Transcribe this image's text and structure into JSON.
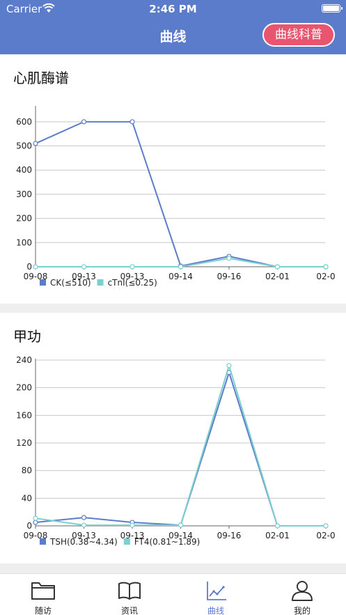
{
  "status": {
    "carrier": "Carrier",
    "time": "2:46 PM"
  },
  "header": {
    "title": "曲线",
    "science_button": "曲线科普"
  },
  "cards": [
    {
      "title": "心肌酶谱",
      "chart_data": {
        "type": "line",
        "categories": [
          "09-08",
          "09-13",
          "09-13",
          "09-14",
          "09-16",
          "02-01",
          "02-0"
        ],
        "ylim": [
          0,
          660
        ],
        "yticks": [
          0,
          100,
          200,
          300,
          400,
          500,
          600
        ],
        "series": [
          {
            "name": "CK(≤510)",
            "color": "#5b7ccb",
            "values": [
              510,
              600,
              600,
              3,
              43,
              0,
              0
            ]
          },
          {
            "name": "cTnI(≤0.25)",
            "color": "#7ccfcf",
            "values": [
              0,
              0,
              0,
              0,
              35,
              0,
              0
            ]
          }
        ]
      }
    },
    {
      "title": "甲功",
      "chart_data": {
        "type": "line",
        "categories": [
          "09-08",
          "09-13",
          "09-13",
          "09-14",
          "09-16",
          "02-01",
          "02-0"
        ],
        "ylim": [
          0,
          240
        ],
        "yticks": [
          0,
          40,
          80,
          120,
          160,
          200,
          240
        ],
        "series": [
          {
            "name": "TSH(0.38~4.34)",
            "color": "#5b7ccb",
            "values": [
              5,
              12,
              5,
              1,
              222,
              0,
              0
            ]
          },
          {
            "name": "FT4(0.81~1.89)",
            "color": "#7ccfcf",
            "values": [
              11,
              1,
              1,
              1,
              232,
              0,
              0
            ]
          }
        ]
      }
    }
  ],
  "tabbar": {
    "items": [
      {
        "label": "随访",
        "icon": "folder-icon"
      },
      {
        "label": "资讯",
        "icon": "book-icon"
      },
      {
        "label": "曲线",
        "icon": "chart-icon",
        "active": true
      },
      {
        "label": "我的",
        "icon": "profile-icon"
      }
    ]
  }
}
